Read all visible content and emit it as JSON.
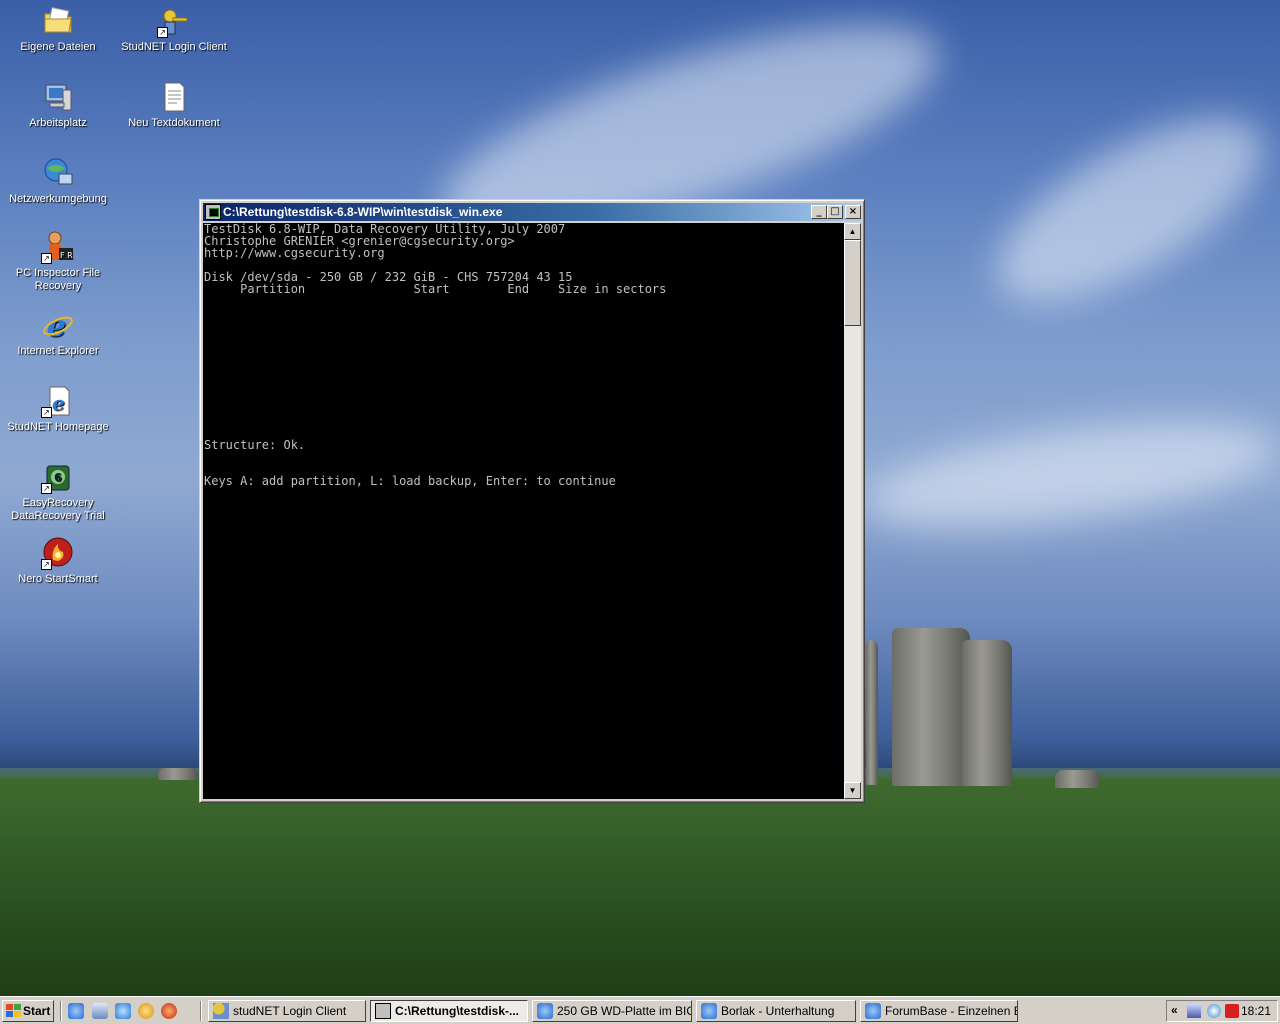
{
  "desktop": {
    "icons": [
      {
        "label": "Eigene Dateien",
        "icon": "folder-icon"
      },
      {
        "label": "StudNET Login Client",
        "icon": "key-login-icon"
      },
      {
        "label": "Arbeitsplatz",
        "icon": "computer-icon"
      },
      {
        "label": "Neu Textdokument",
        "icon": "text-document-icon"
      },
      {
        "label": "Netzwerkumgebung",
        "icon": "network-icon"
      },
      {
        "label": "PC Inspector File Recovery",
        "icon": "file-recovery-icon"
      },
      {
        "label": "Internet Explorer",
        "icon": "internet-explorer-icon"
      },
      {
        "label": "StudNET Homepage",
        "icon": "web-shortcut-icon"
      },
      {
        "label": "EasyRecovery DataRecovery Trial",
        "icon": "easyrecovery-icon"
      },
      {
        "label": "Nero StartSmart",
        "icon": "nero-icon"
      }
    ]
  },
  "window": {
    "title": "C:\\Rettung\\testdisk-6.8-WIP\\win\\testdisk_win.exe",
    "minimize": "_",
    "maximize": "□",
    "close": "×",
    "console_lines": [
      "TestDisk 6.8-WIP, Data Recovery Utility, July 2007",
      "Christophe GRENIER <grenier@cgsecurity.org>",
      "http://www.cgsecurity.org",
      "",
      "Disk /dev/sda - 250 GB / 232 GiB - CHS 757204 43 15",
      "     Partition               Start        End    Size in sectors",
      "",
      "",
      "",
      "",
      "",
      "",
      "",
      "",
      "",
      "",
      "",
      "",
      "Structure: Ok.",
      "",
      "",
      "Keys A: add partition, L: load backup, Enter: to continue"
    ],
    "scroll_up": "▲",
    "scroll_down": "▼"
  },
  "taskbar": {
    "start_label": "Start",
    "tasks": [
      {
        "label": "studNET Login Client",
        "active": false
      },
      {
        "label": "C:\\Rettung\\testdisk-...",
        "active": true
      },
      {
        "label": "250 GB WD-Platte im BIO...",
        "active": false
      },
      {
        "label": "Borlak - Unterhaltung",
        "active": false
      },
      {
        "label": "ForumBase - Einzelnen B...",
        "active": false
      }
    ],
    "tray_chevron": "«",
    "clock": "18:21"
  },
  "colors": {
    "title_active": "#0a246a",
    "console_bg": "#000000",
    "console_fg": "#c0c0c0",
    "face": "#d4d0c8"
  }
}
